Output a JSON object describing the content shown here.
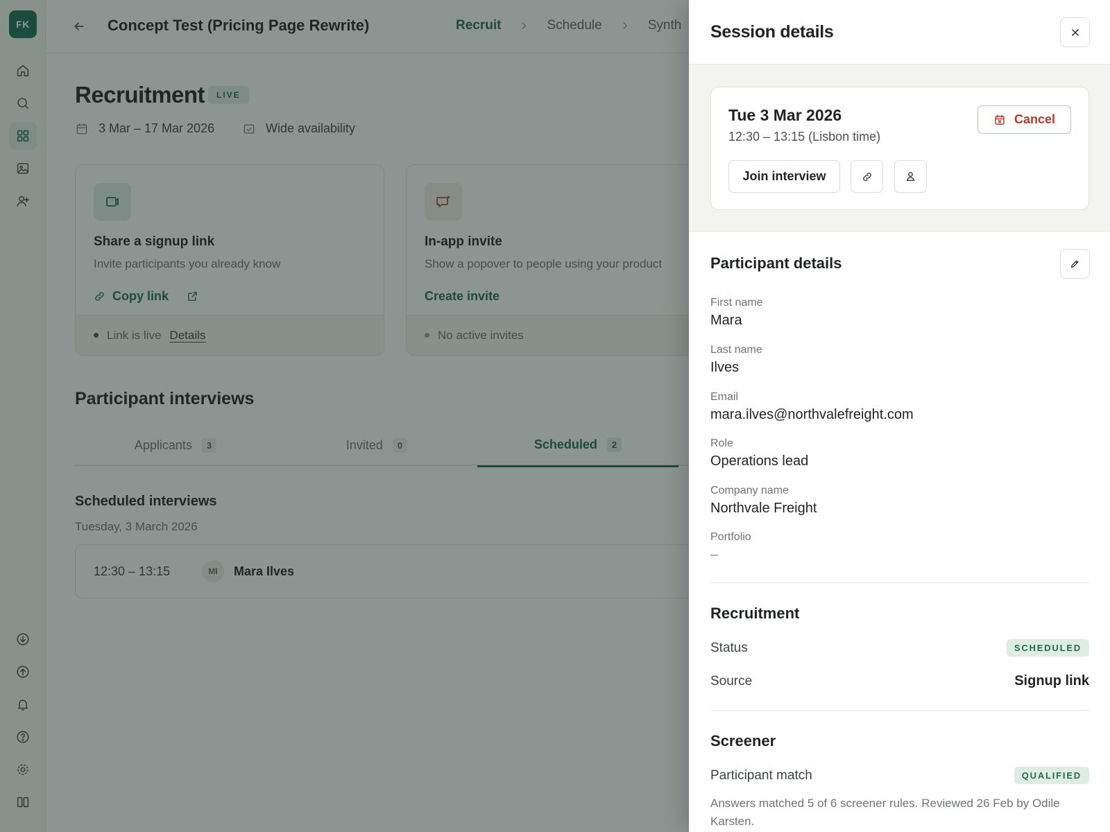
{
  "app": {
    "user_initials": "FK",
    "accent_color": "#1f6b54",
    "danger_color": "#b23a2b"
  },
  "rail": {
    "top_icons": [
      "home-icon",
      "search-icon",
      "grid-icon",
      "image-icon",
      "user-plus-icon"
    ],
    "bottom_icons": [
      "download-icon",
      "upload-icon",
      "bell-icon",
      "help-icon",
      "settings-icon",
      "book-icon"
    ],
    "active_icon": "grid-icon"
  },
  "header": {
    "project_title": "Concept Test (Pricing Page Rewrite)",
    "steps": [
      "Recruit",
      "Schedule",
      "Synth"
    ],
    "active_step": "Recruit"
  },
  "recruitment": {
    "title": "Recruitment",
    "badge": "LIVE",
    "date_range": "3 Mar – 17 Mar 2026",
    "availability": "Wide availability"
  },
  "cards": {
    "signup": {
      "title": "Share a signup link",
      "subtitle": "Invite participants you already know",
      "action": "Copy link",
      "status": "Link is live",
      "details_link": "Details"
    },
    "inapp": {
      "title": "In-app invite",
      "subtitle": "Show a popover to people using your product",
      "action": "Create invite",
      "status": "No active invites"
    }
  },
  "interviews": {
    "title": "Participant interviews",
    "tabs": [
      {
        "label": "Applicants",
        "count": "3"
      },
      {
        "label": "Invited",
        "count": "0"
      },
      {
        "label": "Scheduled",
        "count": "2"
      }
    ],
    "active_tab": "Scheduled",
    "scheduled_title": "Scheduled interviews",
    "scheduled_date": "Tuesday, 3 March 2026",
    "row": {
      "time": "12:30 – 13:15",
      "initials": "MI",
      "name": "Mara Ilves"
    }
  },
  "drawer": {
    "title": "Session details",
    "session": {
      "date": "Tue 3 Mar 2026",
      "time": "12:30 – 13:15 (Lisbon time)",
      "cancel_label": "Cancel",
      "join_label": "Join interview"
    },
    "participant": {
      "title": "Participant details",
      "fields": [
        {
          "label": "First name",
          "value": "Mara"
        },
        {
          "label": "Last name",
          "value": "Ilves"
        },
        {
          "label": "Email",
          "value": "mara.ilves@northvalefreight.com"
        },
        {
          "label": "Role",
          "value": "Operations lead"
        },
        {
          "label": "Company name",
          "value": "Northvale Freight"
        },
        {
          "label": "Portfolio",
          "value": "–"
        }
      ]
    },
    "recruitment": {
      "title": "Recruitment",
      "status_label": "Status",
      "status_value": "SCHEDULED",
      "source_label": "Source",
      "source_value": "Signup link"
    },
    "screener": {
      "title": "Screener",
      "match_label": "Participant match",
      "match_value": "QUALIFIED",
      "note": "Answers matched 5 of 6 screener rules. Reviewed 26 Feb by Odile Karsten."
    }
  }
}
